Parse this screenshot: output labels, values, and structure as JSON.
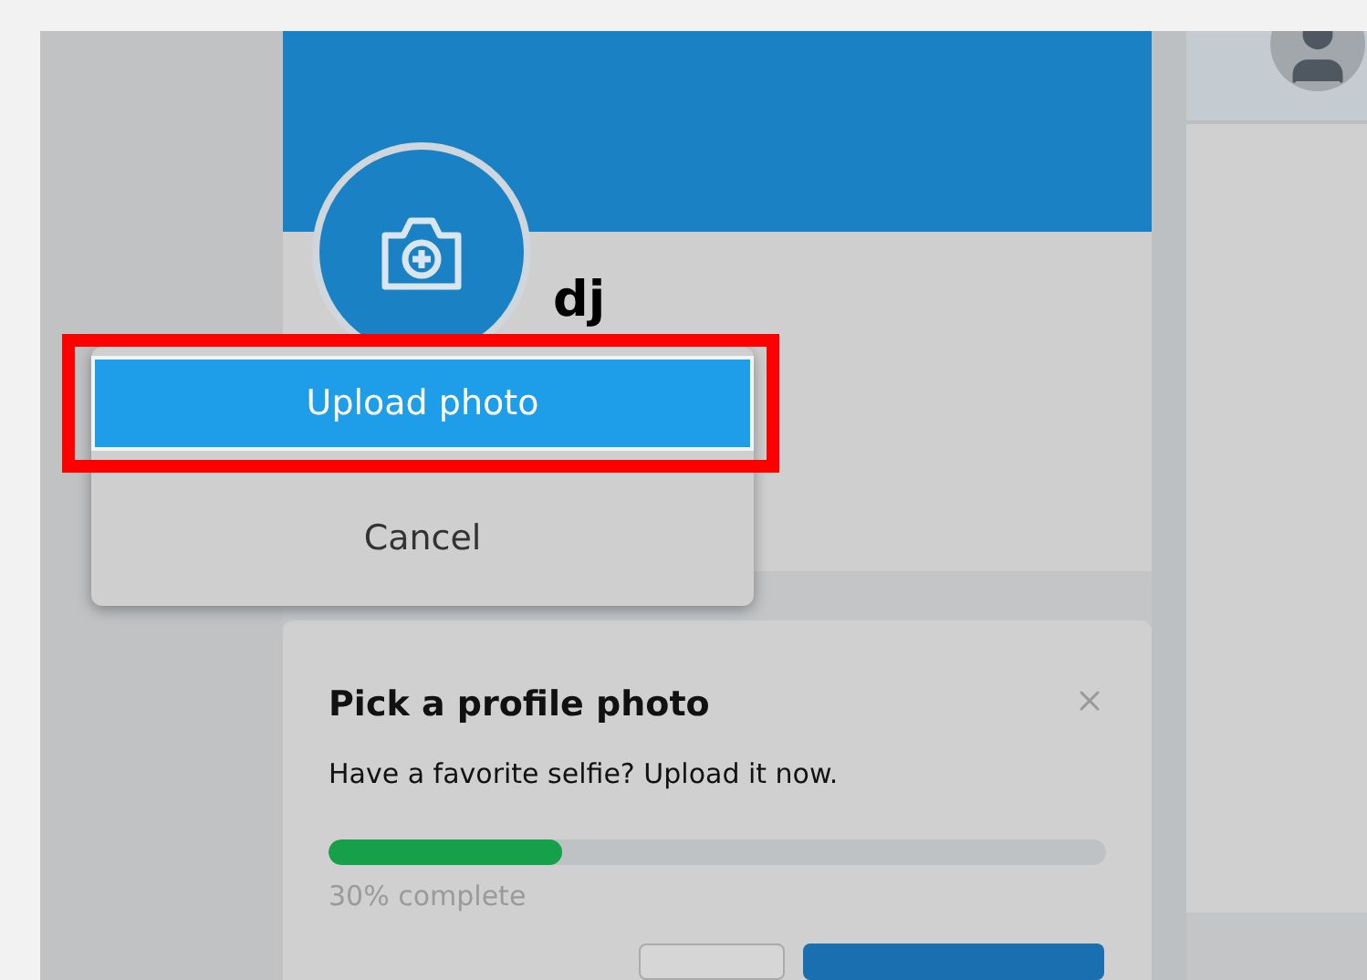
{
  "profile": {
    "name": "dj"
  },
  "photo_menu": {
    "items": [
      {
        "label": "Upload photo",
        "selected": true,
        "annotated": true
      },
      {
        "label": "Cancel",
        "selected": false,
        "annotated": false
      }
    ]
  },
  "profile_card": {
    "title": "Pick a profile photo",
    "text": "Have a favorite selfie? Upload it now.",
    "progress": {
      "level": 0.3
    },
    "reading": "30% complete"
  }
}
